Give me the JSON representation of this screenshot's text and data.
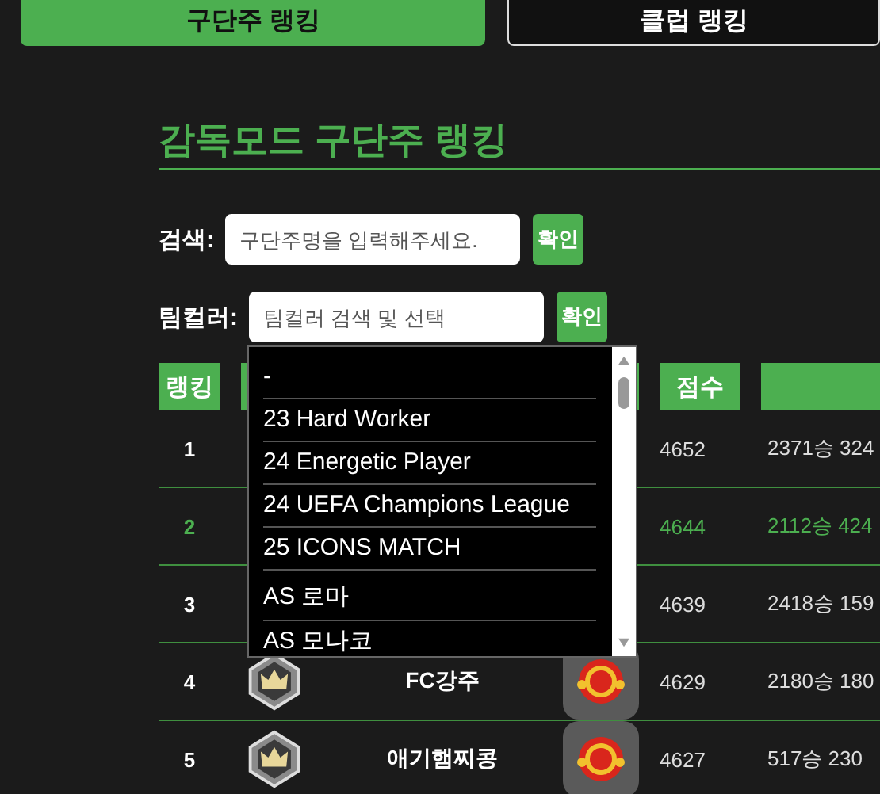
{
  "tabs": [
    {
      "label": "구단주 랭킹",
      "selected": true
    },
    {
      "label": "클럽 랭킹",
      "selected": false
    }
  ],
  "heading": "감독모드 구단주 랭킹",
  "search": {
    "label": "검색:",
    "placeholder": "구단주명을 입력해주세요.",
    "button": "확인"
  },
  "team_color": {
    "label": "팀컬러:",
    "placeholder": "팀컬러 검색 및 선택",
    "button": "확인",
    "dropdown": {
      "options": [
        "-",
        "23 Hard Worker",
        "24 Energetic Player",
        "24 UEFA Champions League",
        "25 ICONS MATCH",
        "AS 로마",
        "AS 모나코"
      ]
    }
  },
  "table": {
    "columns": [
      {
        "kind": "text",
        "label": "랭킹"
      },
      {
        "kind": "blank"
      },
      {
        "kind": "blank"
      },
      {
        "kind": "text",
        "label": "점수"
      },
      {
        "kind": "blank"
      }
    ],
    "rows": [
      {
        "rank": "1",
        "highlight": false,
        "score": "4652",
        "record": "2371승 324"
      },
      {
        "rank": "2",
        "highlight": true,
        "score": "4644",
        "record": "2112승 424"
      },
      {
        "rank": "3",
        "highlight": false,
        "score": "4639",
        "record": "2418승 159"
      },
      {
        "rank": "4",
        "highlight": false,
        "badge": true,
        "name": "FC강주",
        "club_logo": true,
        "score": "4629",
        "record": "2180승 180"
      },
      {
        "rank": "5",
        "highlight": false,
        "badge": true,
        "name": "애기햄찌콩",
        "club_logo": true,
        "score": "4627",
        "record": "517승 230"
      }
    ]
  }
}
